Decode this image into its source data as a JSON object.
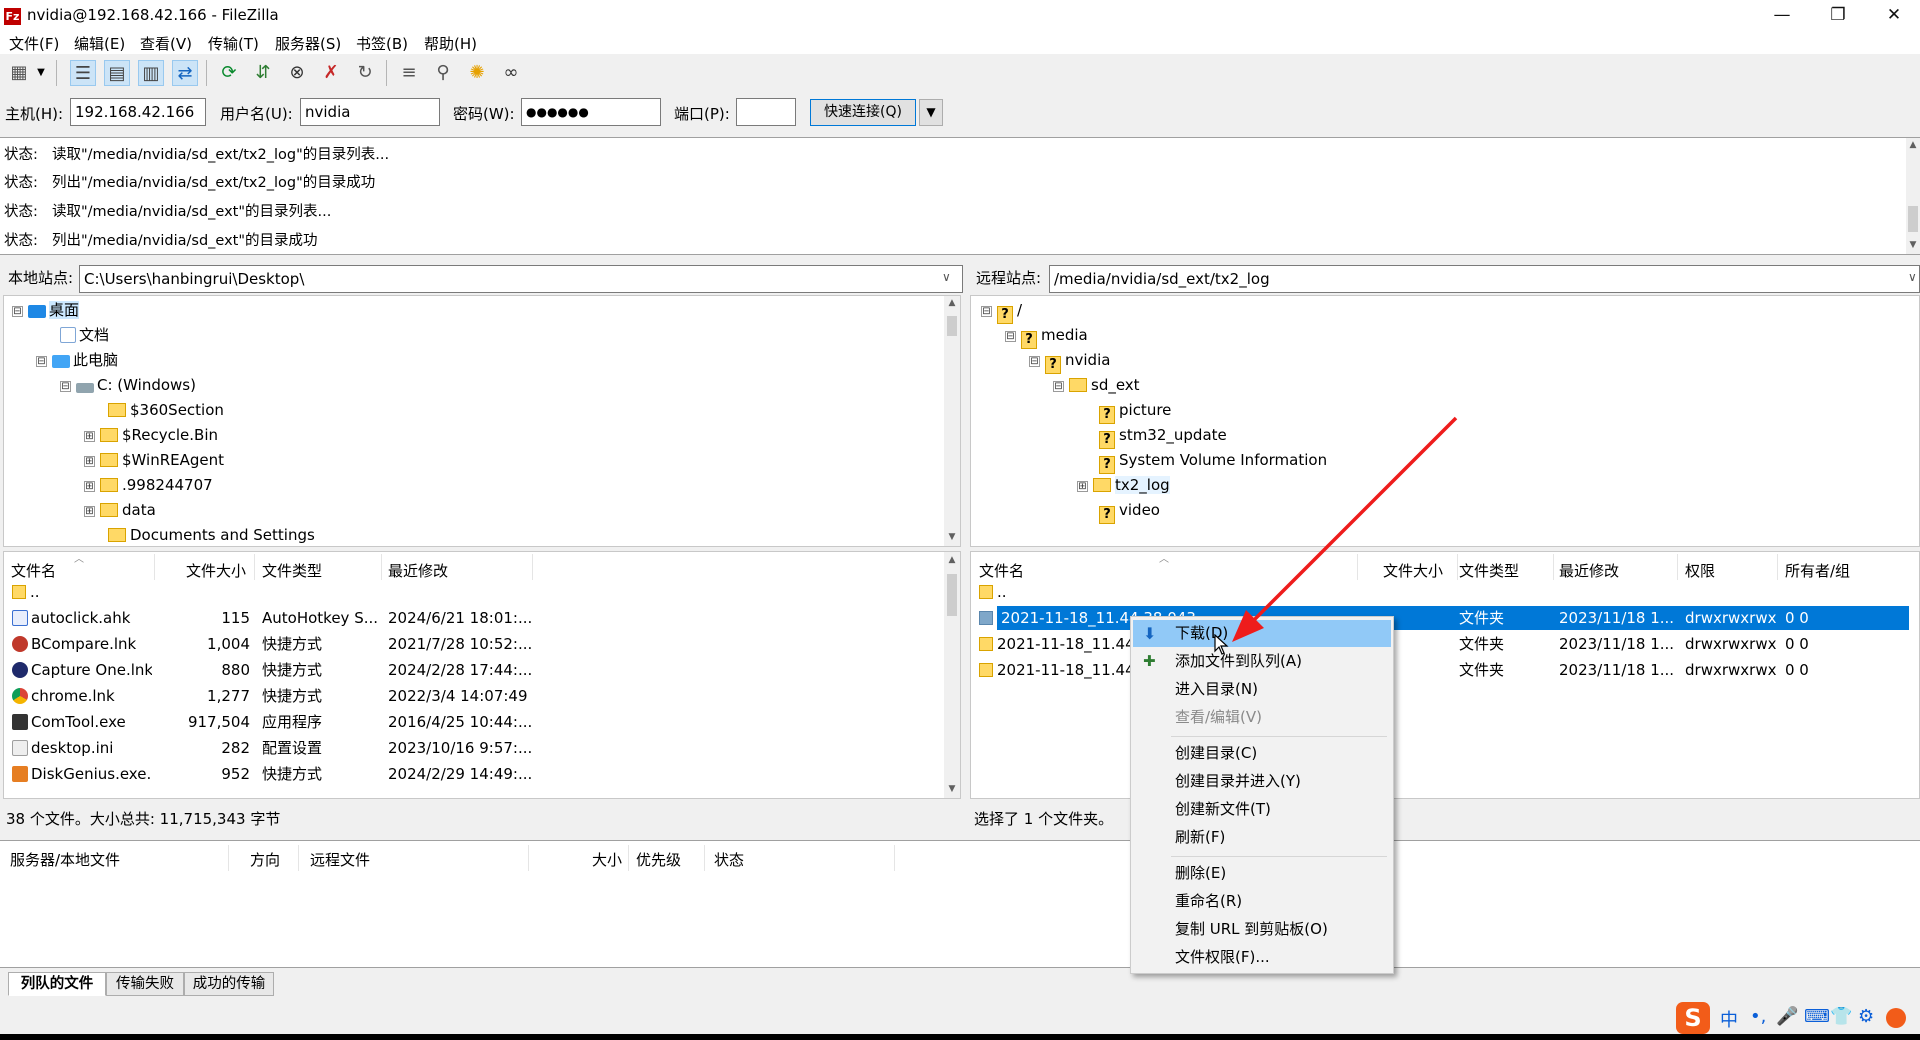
{
  "window": {
    "title": "nvidia@192.168.42.166 - FileZilla",
    "app_icon": "Fz",
    "controls": {
      "minimize": "—",
      "maximize": "❐",
      "close": "✕"
    }
  },
  "menu": [
    "文件(F)",
    "编辑(E)",
    "查看(V)",
    "传输(T)",
    "服务器(S)",
    "书签(B)",
    "帮助(H)"
  ],
  "quickconnect": {
    "host_label": "主机(H):",
    "host_value": "192.168.42.166",
    "user_label": "用户名(U):",
    "user_value": "nvidia",
    "pass_label": "密码(W):",
    "pass_value": "●●●●●●",
    "port_label": "端口(P):",
    "port_value": "",
    "button": "快速连接(Q)",
    "dropdown": "▼"
  },
  "log": [
    {
      "label": "状态:",
      "text": "读取\"/media/nvidia/sd_ext/tx2_log\"的目录列表..."
    },
    {
      "label": "状态:",
      "text": "列出\"/media/nvidia/sd_ext/tx2_log\"的目录成功"
    },
    {
      "label": "状态:",
      "text": "读取\"/media/nvidia/sd_ext\"的目录列表..."
    },
    {
      "label": "状态:",
      "text": "列出\"/media/nvidia/sd_ext\"的目录成功"
    }
  ],
  "local": {
    "site_label": "本地站点:",
    "path": "C:\\Users\\hanbingrui\\Desktop\\",
    "tree": [
      {
        "label": "桌面",
        "exp": "⊟"
      },
      {
        "label": "文档",
        "exp": ""
      },
      {
        "label": "此电脑",
        "exp": "⊟"
      },
      {
        "label": "C: (Windows)",
        "exp": "⊟"
      },
      {
        "label": "$360Section",
        "exp": ""
      },
      {
        "label": "$Recycle.Bin",
        "exp": "⊞"
      },
      {
        "label": "$WinREAgent",
        "exp": "⊞"
      },
      {
        "label": ".998244707",
        "exp": "⊞"
      },
      {
        "label": "data",
        "exp": "⊞"
      },
      {
        "label": "Documents and Settings",
        "exp": ""
      }
    ],
    "columns": [
      "文件名",
      "文件大小",
      "文件类型",
      "最近修改"
    ],
    "files": [
      {
        "name": "..",
        "size": "",
        "type": "",
        "date": "",
        "color": "#ffd966"
      },
      {
        "name": "autoclick.ahk",
        "size": "115",
        "type": "AutoHotkey S...",
        "date": "2024/6/21 18:01:...",
        "color": "#3a6fd1"
      },
      {
        "name": "BCompare.lnk",
        "size": "1,004",
        "type": "快捷方式",
        "date": "2021/7/28 10:52:...",
        "color": "#c0392b"
      },
      {
        "name": "Capture One.lnk",
        "size": "880",
        "type": "快捷方式",
        "date": "2024/2/28 17:44:...",
        "color": "#1f2a6b"
      },
      {
        "name": "chrome.lnk",
        "size": "1,277",
        "type": "快捷方式",
        "date": "2022/3/4 14:07:49",
        "color": "#e0a800"
      },
      {
        "name": "ComTool.exe",
        "size": "917,504",
        "type": "应用程序",
        "date": "2016/4/25 10:44:...",
        "color": "#333333"
      },
      {
        "name": "desktop.ini",
        "size": "282",
        "type": "配置设置",
        "date": "2023/10/16 9:57:...",
        "color": "#9e9e9e"
      },
      {
        "name": "DiskGenius.exe...",
        "size": "952",
        "type": "快捷方式",
        "date": "2024/2/29 14:49:...",
        "color": "#e67e22"
      }
    ],
    "status": "38 个文件。大小总共: 11,715,343 字节"
  },
  "remote": {
    "site_label": "远程站点:",
    "path": "/media/nvidia/sd_ext/tx2_log",
    "tree": [
      {
        "label": "/",
        "exp": "⊟",
        "icon": "q"
      },
      {
        "label": "media",
        "exp": "⊟",
        "icon": "q"
      },
      {
        "label": "nvidia",
        "exp": "⊟",
        "icon": "q"
      },
      {
        "label": "sd_ext",
        "exp": "⊟",
        "icon": "f"
      },
      {
        "label": "picture",
        "exp": "",
        "icon": "q"
      },
      {
        "label": "stm32_update",
        "exp": "",
        "icon": "q"
      },
      {
        "label": "System Volume Information",
        "exp": "",
        "icon": "q"
      },
      {
        "label": "tx2_log",
        "exp": "⊞",
        "icon": "f"
      },
      {
        "label": "video",
        "exp": "",
        "icon": "q"
      }
    ],
    "columns": [
      "文件名",
      "文件大小",
      "文件类型",
      "最近修改",
      "权限",
      "所有者/组"
    ],
    "files": [
      {
        "name": "..",
        "type": "",
        "date": "",
        "perm": "",
        "owner": ""
      },
      {
        "name": "2021-11-18_11.44.38.043",
        "type": "文件夹",
        "date": "2023/11/18 1...",
        "perm": "drwxrwxrwx",
        "owner": "0 0",
        "selected": true
      },
      {
        "name": "2021-11-18_11.44",
        "type": "文件夹",
        "date": "2023/11/18 1...",
        "perm": "drwxrwxrwx",
        "owner": "0 0"
      },
      {
        "name": "2021-11-18_11.44",
        "type": "文件夹",
        "date": "2023/11/18 1...",
        "perm": "drwxrwxrwx",
        "owner": "0 0"
      }
    ],
    "status": "选择了 1 个文件夹。"
  },
  "context_menu": [
    {
      "label": "下载(D)",
      "icon": "⬇",
      "hover": true
    },
    {
      "label": "添加文件到队列(A)",
      "icon": "✚"
    },
    {
      "label": "进入目录(N)"
    },
    {
      "label": "查看/编辑(V)",
      "disabled": true
    },
    {
      "sep": true
    },
    {
      "label": "创建目录(C)"
    },
    {
      "label": "创建目录并进入(Y)"
    },
    {
      "label": "创建新文件(T)"
    },
    {
      "label": "刷新(F)"
    },
    {
      "sep": true
    },
    {
      "label": "删除(E)"
    },
    {
      "label": "重命名(R)"
    },
    {
      "label": "复制 URL 到剪贴板(O)"
    },
    {
      "label": "文件权限(F)..."
    }
  ],
  "queue": {
    "columns": [
      "服务器/本地文件",
      "方向",
      "远程文件",
      "大小",
      "优先级",
      "状态"
    ],
    "tabs": [
      "列队的文件",
      "传输失败",
      "成功的传输"
    ]
  },
  "ime": {
    "logo": "S",
    "items": [
      "中",
      "•,",
      "🎤",
      "⌨",
      "👕",
      "⚙"
    ]
  }
}
